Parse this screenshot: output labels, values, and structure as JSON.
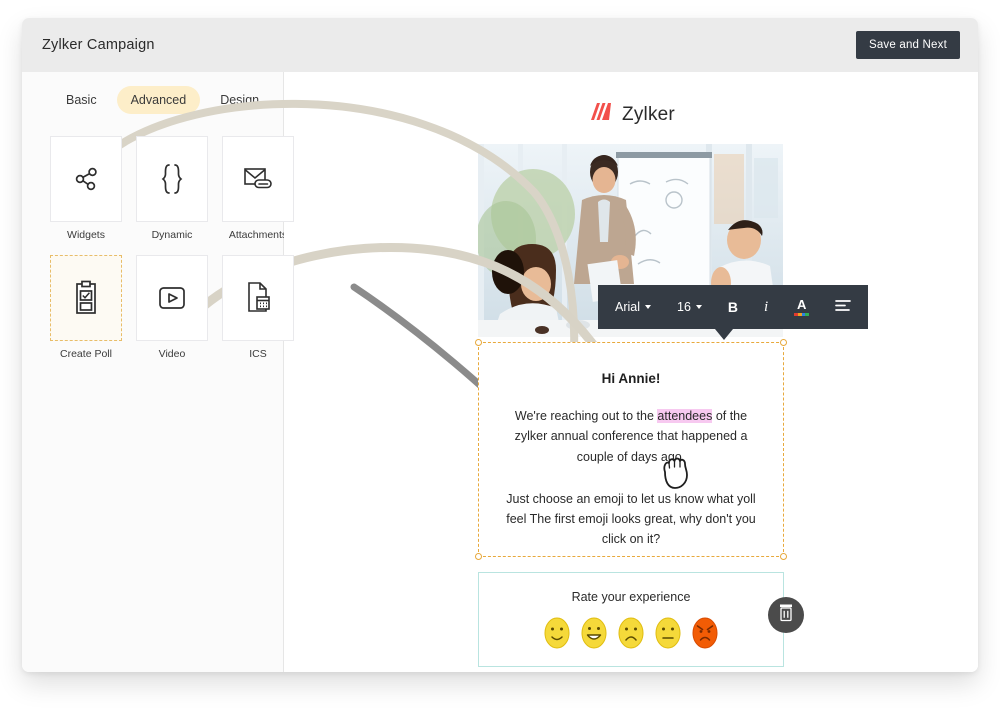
{
  "header": {
    "title": "Zylker Campaign",
    "save_button": "Save and Next"
  },
  "sidebar": {
    "tabs": [
      {
        "label": "Basic",
        "active": false
      },
      {
        "label": "Advanced",
        "active": true
      },
      {
        "label": "Design",
        "active": false
      }
    ],
    "widgets": [
      {
        "label": "Widgets",
        "icon": "share-nodes-icon",
        "selected": false
      },
      {
        "label": "Dynamic",
        "icon": "curly-braces-icon",
        "selected": false
      },
      {
        "label": "Attachments",
        "icon": "mail-attachment-icon",
        "selected": false
      },
      {
        "label": "Create Poll",
        "icon": "clipboard-poll-icon",
        "selected": true
      },
      {
        "label": "Video",
        "icon": "video-play-icon",
        "selected": false
      },
      {
        "label": "ICS",
        "icon": "calendar-document-icon",
        "selected": false
      }
    ]
  },
  "canvas": {
    "brand_name": "Zylker",
    "brand_logo_color": "#f2504b",
    "drop_zone_icon": "clipboard-poll-icon",
    "drag_cursor_icon": "grab-hand-icon",
    "format_toolbar": {
      "font_family": "Arial",
      "font_size": "16",
      "bold_label": "B",
      "italic_label": "i",
      "text_color_label": "A",
      "align_icon": "align-left-icon",
      "background": "#343b44"
    },
    "email": {
      "greeting": "Hi Annie!",
      "paragraph_1_before": "We're reaching out to the ",
      "paragraph_1_highlight": "attendees",
      "paragraph_1_after": " of the zylker annual conference that happened a couple of days ago.",
      "highlight_color": "#f7c9f0",
      "paragraph_2": "Just choose an emoji to let us know what yoll feel The first emoji looks great, why don't you click on it?"
    },
    "poll": {
      "title": "Rate your experience",
      "border_color": "#b9e4e0",
      "emojis": [
        {
          "name": "slight-smile-emoji",
          "color": "#f5d93a"
        },
        {
          "name": "grin-emoji",
          "color": "#f5d93a"
        },
        {
          "name": "frown-emoji",
          "color": "#f5d93a"
        },
        {
          "name": "neutral-emoji",
          "color": "#f5d93a"
        },
        {
          "name": "angry-emoji",
          "color": "#f25c05"
        }
      ],
      "delete_icon": "trash-icon"
    }
  }
}
